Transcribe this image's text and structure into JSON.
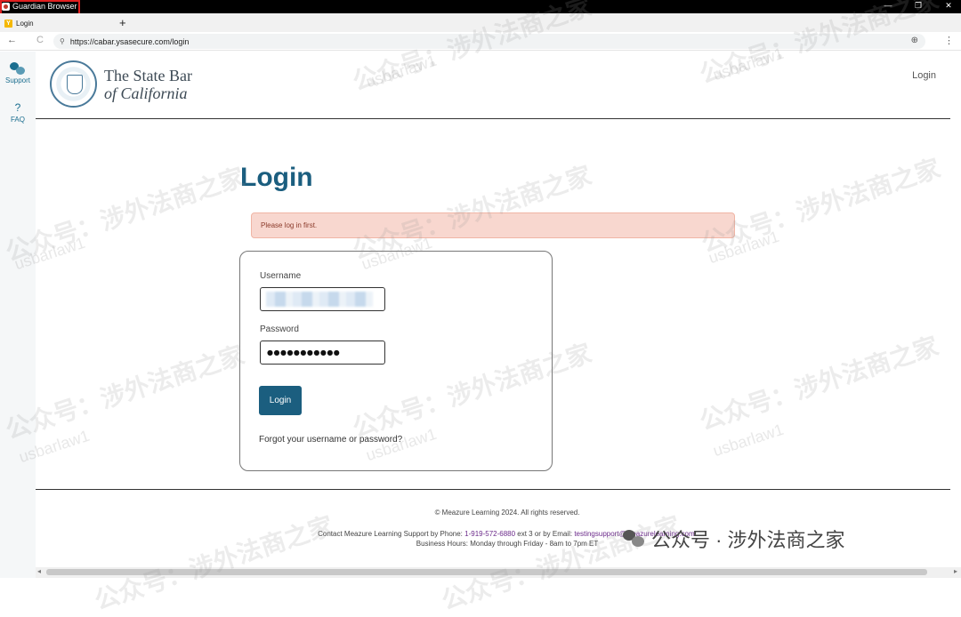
{
  "window": {
    "title": "Guardian Browser",
    "controls": [
      "—",
      "❐",
      "✕"
    ]
  },
  "tabs": [
    {
      "label": "Login",
      "favicon": "Y"
    }
  ],
  "new_tab_label": "+",
  "address_bar": {
    "url": "https://cabar.ysasecure.com/login"
  },
  "nav_icons": {
    "back": "←",
    "reload": "C",
    "site_info": "⚲",
    "zoom": "⊕",
    "menu": "⋮"
  },
  "sidebar": {
    "items": [
      {
        "label": "Support",
        "icon": "chat-bubbles-icon"
      },
      {
        "label": "FAQ",
        "icon": "question-mark-icon",
        "glyph": "?"
      }
    ]
  },
  "header": {
    "brand_line1": "The State Bar",
    "brand_line2": "of California",
    "login_link": "Login"
  },
  "main": {
    "title": "Login",
    "alert": "Please log in first.",
    "form": {
      "username_label": "Username",
      "username_value": "",
      "password_label": "Password",
      "password_value": "●●●●●●●●●●●",
      "submit_label": "Login",
      "forgot_link": "Forgot your username or password?"
    }
  },
  "footer": {
    "copyright": "© Meazure Learning 2024. All rights reserved.",
    "contact_prefix": "Contact Meazure Learning Support by Phone: ",
    "phone": "1-919-572-6880",
    "contact_middle": " ext 3 or by Email: ",
    "email": "testingsupport@meazurelearning.com",
    "contact_suffix": "!",
    "hours": "Business Hours: Monday through Friday - 8am to 7pm ET"
  },
  "watermarks": {
    "cn": "公众号：涉外法商之家",
    "en": "usbarlaw1",
    "bottom": "公众号 · 涉外法商之家"
  },
  "colors": {
    "primary": "#1b5e7f",
    "alert_bg": "#f8d7cf",
    "titlebar": "#000000",
    "highlight": "#e02020"
  }
}
